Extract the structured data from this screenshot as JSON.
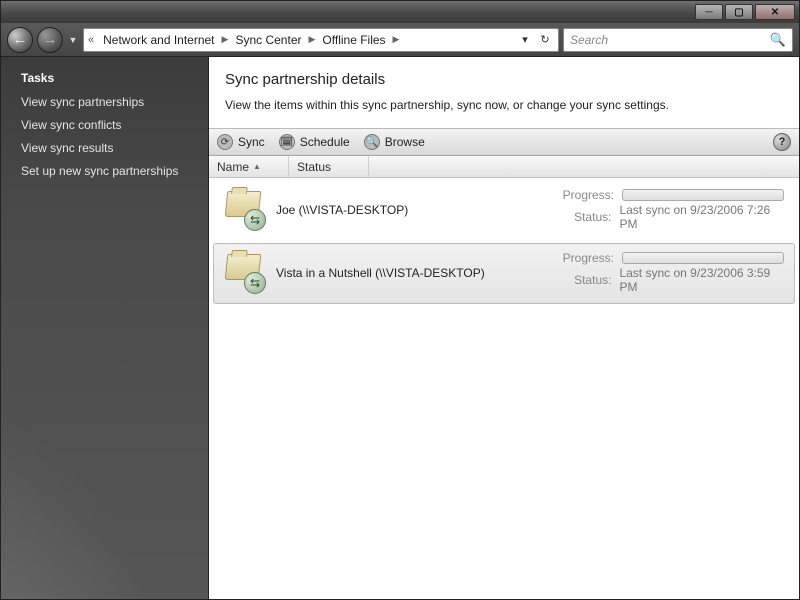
{
  "breadcrumb": {
    "back_hint": "«",
    "items": [
      "Network and Internet",
      "Sync Center",
      "Offline Files"
    ]
  },
  "search": {
    "placeholder": "Search"
  },
  "sidebar": {
    "heading": "Tasks",
    "items": [
      {
        "label": "View sync partnerships"
      },
      {
        "label": "View sync conflicts"
      },
      {
        "label": "View sync results"
      },
      {
        "label": "Set up new sync partnerships"
      }
    ]
  },
  "page": {
    "title": "Sync partnership details",
    "subtitle": "View the items within this sync partnership, sync now, or change your sync settings."
  },
  "toolbar": {
    "sync": "Sync",
    "schedule": "Schedule",
    "browse": "Browse"
  },
  "columns": {
    "name": "Name",
    "status": "Status"
  },
  "labels": {
    "progress": "Progress:",
    "status": "Status:"
  },
  "rows": [
    {
      "name": "Joe (\\\\VISTA-DESKTOP)",
      "status": "Last sync on 9/23/2006 7:26 PM",
      "selected": false
    },
    {
      "name": "Vista in a Nutshell (\\\\VISTA-DESKTOP)",
      "status": "Last sync on 9/23/2006 3:59 PM",
      "selected": true
    }
  ]
}
